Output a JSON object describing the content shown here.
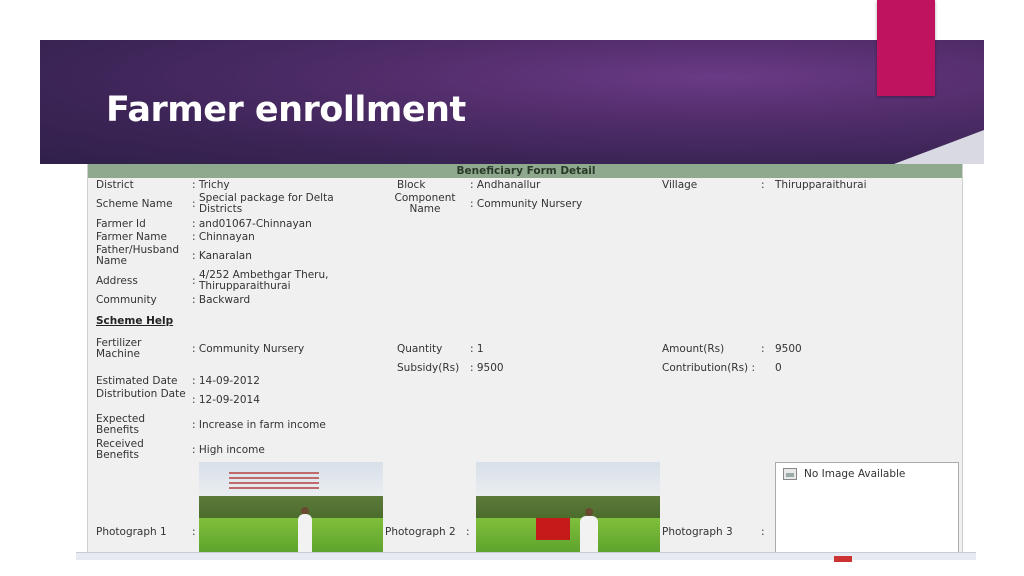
{
  "slide": {
    "title": "Farmer enrollment"
  },
  "form": {
    "header": "Beneficiary Form Detail",
    "district": {
      "label": "District",
      "value": ": Trichy"
    },
    "block": {
      "label": "Block",
      "value": ": Andhanallur"
    },
    "village": {
      "label": "Village",
      "colon": ":",
      "value": "Thirupparaithurai"
    },
    "scheme_name": {
      "label": "Scheme Name",
      "colon": ":",
      "value": "Special package for Delta Districts"
    },
    "component_name": {
      "label": "Component Name",
      "value": ": Community Nursery"
    },
    "farmer_id": {
      "label": "Farmer Id",
      "value": ": and01067-Chinnayan"
    },
    "farmer_name": {
      "label": "Farmer Name",
      "value": ": Chinnayan"
    },
    "father_husband_name": {
      "label": "Father/Husband Name",
      "value": ": Kanaralan"
    },
    "address": {
      "label": "Address",
      "colon": ":",
      "value": "4/252 Ambethgar Theru, Thirupparaithurai"
    },
    "community": {
      "label": "Community",
      "value": ": Backward"
    },
    "scheme_help": "Scheme Help",
    "fertilizer_machine": {
      "label": "Fertilizer Machine",
      "value": ": Community Nursery"
    },
    "quantity": {
      "label": "Quantity",
      "value": ": 1"
    },
    "amount": {
      "label": "Amount(Rs)",
      "colon": ":",
      "value": "9500"
    },
    "subsidy": {
      "label": "Subsidy(Rs)",
      "value": ": 9500"
    },
    "contribution": {
      "label": "Contribution(Rs) :",
      "value": "0"
    },
    "estimated_date": {
      "label": "Estimated Date",
      "value": ": 14-09-2012"
    },
    "distribution_date": {
      "label": "Distribution Date",
      "value": ": 12-09-2014"
    },
    "expected_benefits": {
      "label": "Expected Benefits",
      "value": ": Increase in farm income"
    },
    "received_benefits": {
      "label": "Received Benefits",
      "value": ": High income"
    },
    "photograph_1": {
      "label": "Photograph 1",
      "colon": ":"
    },
    "photograph_2": {
      "label": "Photograph 2",
      "colon": ":"
    },
    "photograph_3": {
      "label": "Photograph 3",
      "colon": ":",
      "placeholder": "No Image Available"
    }
  },
  "icons": {
    "no_image": "broken-image-icon",
    "taskbar": "taskbar-app-icon"
  },
  "colors": {
    "accent": "#c0135f",
    "banner": "#3b2456",
    "form_header": "#8fa98f"
  }
}
